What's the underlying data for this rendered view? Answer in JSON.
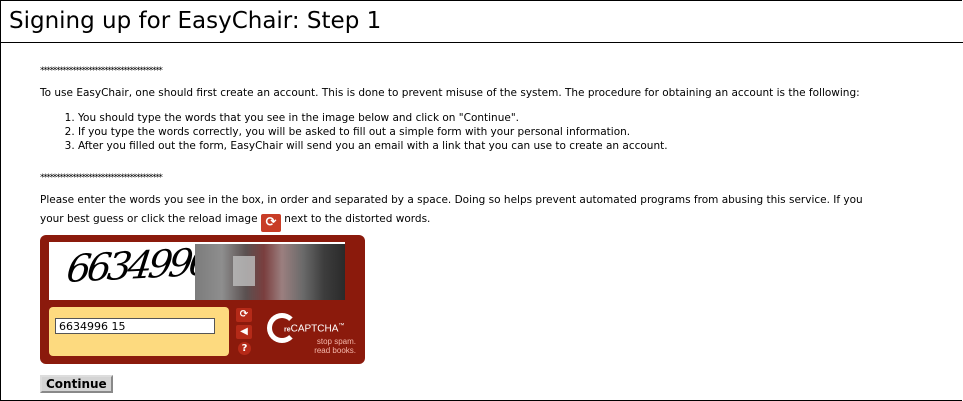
{
  "page": {
    "title": "Signing up for EasyChair: Step 1",
    "separator": "**************************************",
    "intro": "To use EasyChair, one should first create an account. This is done to prevent misuse of the system. The procedure for obtaining an account is the following:",
    "steps": [
      "You should type the words that you see in the image below and click on \"Continue\".",
      "If you type the words correctly, you will be asked to fill out a simple form with your personal information.",
      "After you filled out the form, EasyChair will send you an email with a link that you can use to create an account."
    ],
    "instructions_line1": "Please enter the words you see in the box, in order and separated by a space. Doing so helps prevent automated programs from abusing this service. If you",
    "instructions_line2_before": "your best guess or click the reload image",
    "instructions_line2_after": "next to the distorted words."
  },
  "captcha": {
    "distorted_text": "6634996",
    "answer_value": "6634996 15",
    "reload_icon": "refresh-icon",
    "audio_icon": "speaker-icon",
    "help_icon": "help-icon",
    "brand_prefix": "re",
    "brand_name": "CAPTCHA",
    "brand_tm": "™",
    "tagline1": "stop spam.",
    "tagline2": "read books."
  },
  "form": {
    "continue_label": "Continue"
  }
}
